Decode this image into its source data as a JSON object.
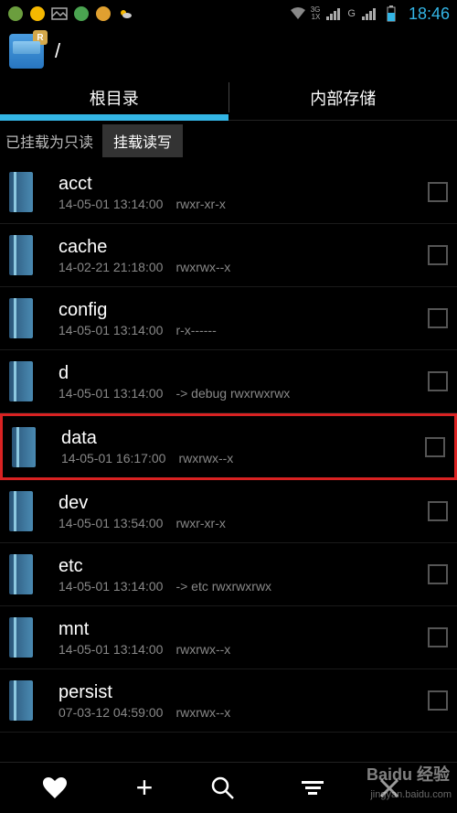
{
  "status": {
    "time": "18:46",
    "network_type": "3G",
    "signal_label": "G"
  },
  "header": {
    "path": "/"
  },
  "tabs": {
    "root": "根目录",
    "internal": "内部存储"
  },
  "mount": {
    "status": "已挂载为只读",
    "button": "挂载读写"
  },
  "files": [
    {
      "name": "acct",
      "date": "14-05-01 13:14:00",
      "perm": "rwxr-xr-x",
      "highlighted": false
    },
    {
      "name": "cache",
      "date": "14-02-21 21:18:00",
      "perm": "rwxrwx--x",
      "highlighted": false
    },
    {
      "name": "config",
      "date": "14-05-01 13:14:00",
      "perm": "r-x------",
      "highlighted": false
    },
    {
      "name": "d",
      "date": "14-05-01 13:14:00",
      "perm": "-> debug  rwxrwxrwx",
      "highlighted": false
    },
    {
      "name": "data",
      "date": "14-05-01 16:17:00",
      "perm": "rwxrwx--x",
      "highlighted": true
    },
    {
      "name": "dev",
      "date": "14-05-01 13:54:00",
      "perm": "rwxr-xr-x",
      "highlighted": false
    },
    {
      "name": "etc",
      "date": "14-05-01 13:14:00",
      "perm": "-> etc  rwxrwxrwx",
      "highlighted": false
    },
    {
      "name": "mnt",
      "date": "14-05-01 13:14:00",
      "perm": "rwxrwx--x",
      "highlighted": false
    },
    {
      "name": "persist",
      "date": "07-03-12 04:59:00",
      "perm": "rwxrwx--x",
      "highlighted": false
    }
  ],
  "watermark": {
    "main": "Baidu 经验",
    "sub": "jingyan.baidu.com"
  }
}
